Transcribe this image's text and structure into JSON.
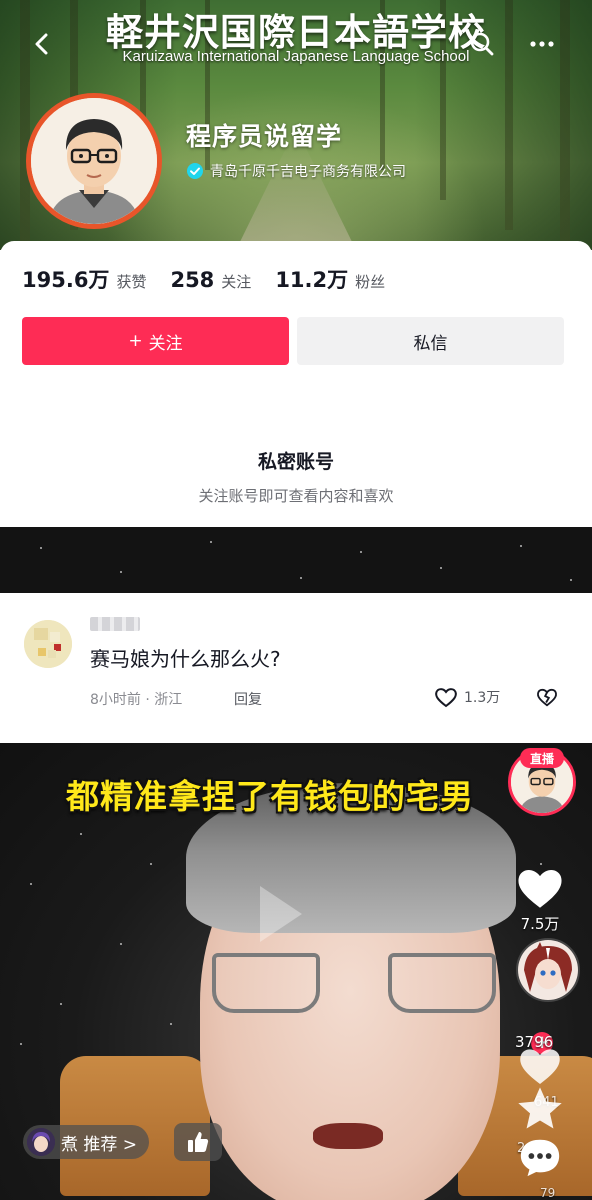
{
  "header": {
    "school_title": "軽井沢国際日本語学校",
    "school_subtitle": "Karuizawa International Japanese Language School",
    "profile_name": "程序员说留学",
    "verified_company": "青岛千原千吉电子商务有限公司"
  },
  "stats": [
    {
      "value": "195.6万",
      "label": "获赞"
    },
    {
      "value": "258",
      "label": "关注"
    },
    {
      "value": "11.2万",
      "label": "粉丝"
    }
  ],
  "actions": {
    "follow_label": "关注",
    "follow_prefix": "+",
    "message_label": "私信"
  },
  "private": {
    "title": "私密账号",
    "description": "关注账号即可查看内容和喜欢"
  },
  "comment": {
    "text": "赛马娘为什么那么火?",
    "time": "8小时前",
    "location": "· 浙江",
    "reply_label": "回复",
    "likes": "1.3万"
  },
  "video": {
    "caption": "都精准拿捏了有钱包的宅男",
    "live_badge": "直播",
    "likes": "7.5万",
    "comments": "3796",
    "favorites": "641",
    "shares_partial": "2",
    "extra_partial": "79",
    "recommend_label": "煮 推荐 >"
  },
  "colors": {
    "accent": "#fe2c55",
    "verified": "#20d5ec",
    "caption_yellow": "#ffe81a"
  }
}
